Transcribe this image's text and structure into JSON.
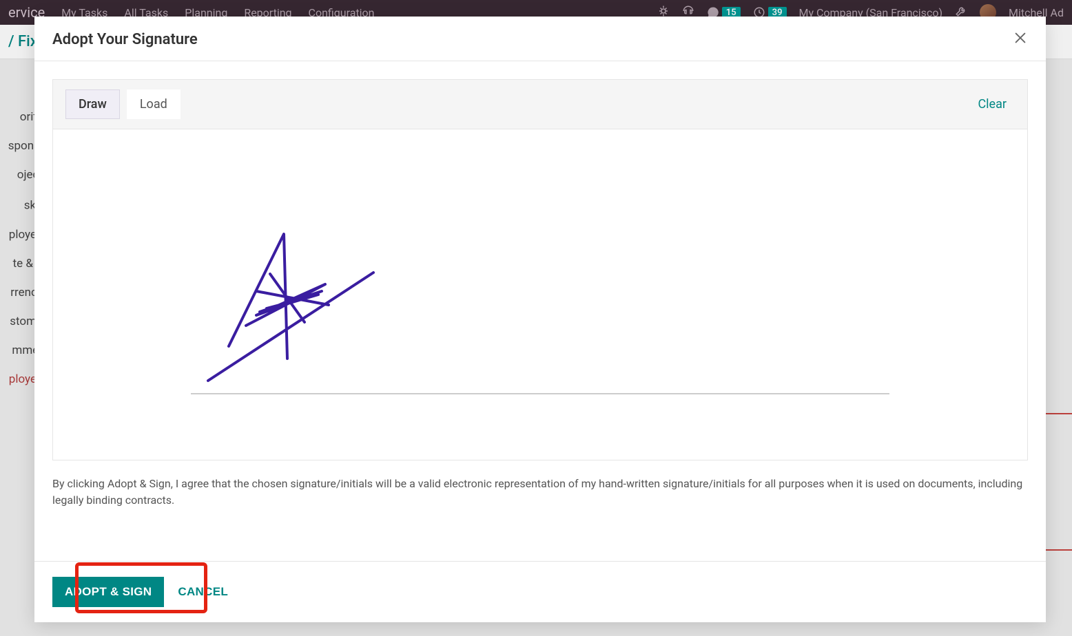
{
  "navbar": {
    "brand": "ervice",
    "items": [
      "My Tasks",
      "All Tasks",
      "Planning",
      "Reporting",
      "Configuration"
    ],
    "company": "My Company (San Francisco)",
    "user": "Mitchell Ad",
    "msg_badge": "15",
    "clock_badge": "39"
  },
  "breadcrumb": {
    "trail": "/ Fix"
  },
  "sidebar": {
    "items": [
      "ority",
      "sponsi",
      "oject",
      "sk",
      "ployee",
      "te & T",
      "rrency",
      "stome",
      "mmer",
      "ployee"
    ],
    "q": "?"
  },
  "modal": {
    "title": "Adopt Your Signature",
    "tabs": {
      "draw": "Draw",
      "load": "Load"
    },
    "clear": "Clear",
    "disclaimer": "By clicking Adopt & Sign, I agree that the chosen signature/initials will be a valid electronic representation of my hand-written signature/initials for all purposes when it is used on documents, including legally binding contracts.",
    "adopt": "ADOPT & SIGN",
    "cancel": "CANCEL"
  },
  "colors": {
    "teal": "#008784",
    "highlight": "#e42312",
    "signature_ink": "#3a1da0"
  }
}
